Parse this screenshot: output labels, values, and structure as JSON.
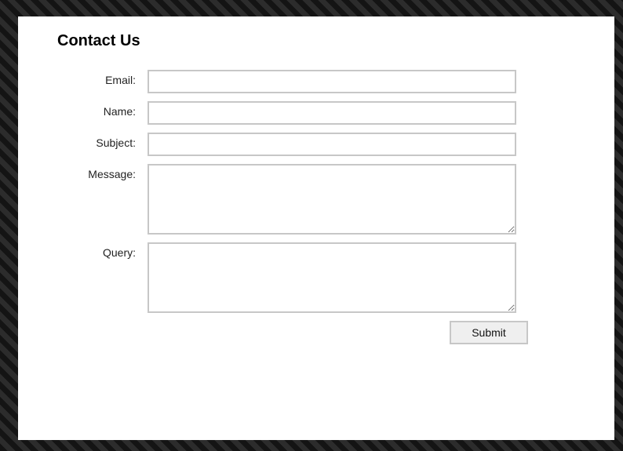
{
  "form": {
    "title": "Contact Us",
    "fields": {
      "email": {
        "label": "Email:",
        "value": "",
        "placeholder": ""
      },
      "name": {
        "label": "Name:",
        "value": "",
        "placeholder": ""
      },
      "subject": {
        "label": "Subject:",
        "value": "",
        "placeholder": ""
      },
      "message": {
        "label": "Message:",
        "value": "",
        "placeholder": ""
      },
      "query": {
        "label": "Query:",
        "value": "",
        "placeholder": ""
      }
    },
    "submit_label": "Submit"
  }
}
